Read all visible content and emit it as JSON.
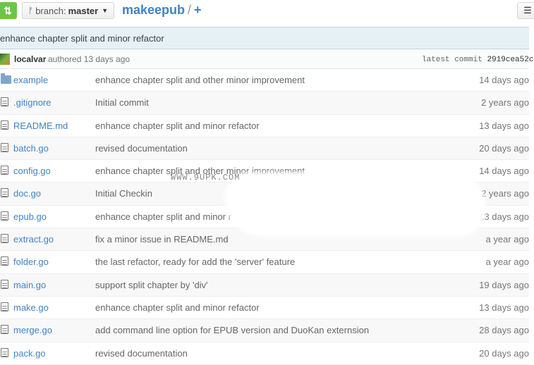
{
  "header": {
    "branch_prefix": "branch:",
    "branch_name": "master",
    "repo_name": "makeepub",
    "path_sep": "/",
    "path_plus": "+",
    "sync_icon": "sync-icon",
    "list_icon": "list-icon"
  },
  "commit": {
    "message": "enhance chapter split and minor refactor",
    "author": "localvar",
    "authored": "authored 13 days ago",
    "latest_label": "latest commit",
    "sha": "2919cea52c"
  },
  "files": [
    {
      "type": "folder",
      "name": "example",
      "message": "enhance chapter split and other minor improvement",
      "age": "14 days ago"
    },
    {
      "type": "file",
      "name": ".gitignore",
      "message": "Initial commit",
      "age": "2 years ago"
    },
    {
      "type": "file",
      "name": "README.md",
      "message": "enhance chapter split and minor refactor",
      "age": "13 days ago"
    },
    {
      "type": "file",
      "name": "batch.go",
      "message": "revised documentation",
      "age": "20 days ago"
    },
    {
      "type": "file",
      "name": "config.go",
      "message": "enhance chapter split and other minor improvement",
      "age": "14 days ago"
    },
    {
      "type": "file",
      "name": "doc.go",
      "message": "Initial Checkin",
      "age": "2 years ago"
    },
    {
      "type": "file",
      "name": "epub.go",
      "message": "enhance chapter split and minor r",
      "age": "13 days ago"
    },
    {
      "type": "file",
      "name": "extract.go",
      "message": "fix a minor issue in README.md",
      "age": "a year ago"
    },
    {
      "type": "file",
      "name": "folder.go",
      "message": "the last refactor, ready for add the 'server' feature",
      "age": "a year ago"
    },
    {
      "type": "file",
      "name": "main.go",
      "message": "support split chapter by 'div'",
      "age": "19 days ago"
    },
    {
      "type": "file",
      "name": "make.go",
      "message": "enhance chapter split and minor refactor",
      "age": "13 days ago"
    },
    {
      "type": "file",
      "name": "merge.go",
      "message": "add command line option for EPUB version and DuoKan externsion",
      "age": "28 days ago"
    },
    {
      "type": "file",
      "name": "pack.go",
      "message": "revised documentation",
      "age": "20 days ago"
    }
  ],
  "watermark": "WWW.9UPK.COM",
  "colors": {
    "accent": "#4183c4",
    "sync_green": "#6cc644",
    "banner_bg": "#e6f1f6"
  }
}
